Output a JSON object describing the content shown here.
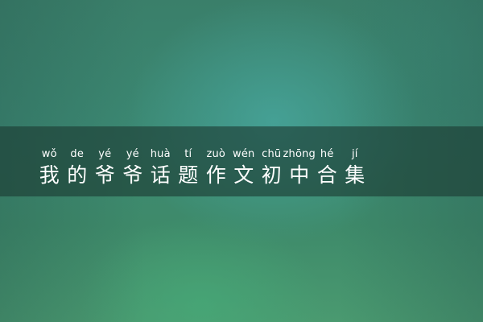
{
  "title": {
    "pinyin": [
      "wǒ",
      "de",
      "yé",
      "yé",
      "huà",
      "tí",
      "zuò",
      "wén",
      "chū",
      "zhōng",
      "hé",
      "jí"
    ],
    "characters": [
      "我",
      "的",
      "爷",
      "爷",
      "话",
      "题",
      "作",
      "文",
      "初",
      "中",
      "合",
      "集"
    ]
  }
}
